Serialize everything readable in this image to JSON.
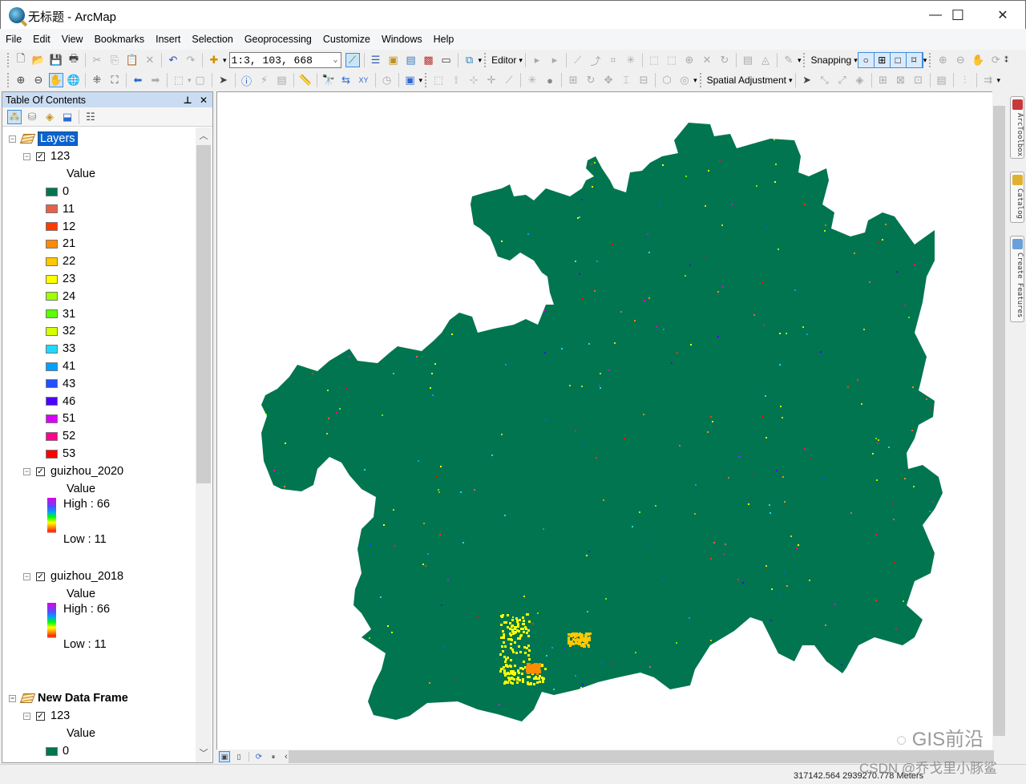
{
  "window": {
    "title": "无标题 - ArcMap",
    "minimize": "—",
    "maximize": "☐",
    "close": "✕"
  },
  "menu": [
    "File",
    "Edit",
    "View",
    "Bookmarks",
    "Insert",
    "Selection",
    "Geoprocessing",
    "Customize",
    "Windows",
    "Help"
  ],
  "toolbar": {
    "scale_value": "1:3, 103, 668",
    "editor_label": "Editor",
    "snapping_label": "Snapping",
    "spatial_adjustment_label": "Spatial Adjustment",
    "dropdown_arrow": "▾"
  },
  "toc": {
    "title": "Table Of Contents",
    "pin": "ᵖ",
    "close": "✕",
    "frames": [
      {
        "name": "Layers",
        "layers": [
          {
            "name": "123",
            "checked": true,
            "field": "Value",
            "classes": [
              {
                "label": "0",
                "color": "#007550"
              },
              {
                "label": "11",
                "color": "#e8604a"
              },
              {
                "label": "12",
                "color": "#ff3a00"
              },
              {
                "label": "21",
                "color": "#ff8c00"
              },
              {
                "label": "22",
                "color": "#ffc800"
              },
              {
                "label": "23",
                "color": "#ffff00"
              },
              {
                "label": "24",
                "color": "#a0ff00"
              },
              {
                "label": "31",
                "color": "#5aff00"
              },
              {
                "label": "32",
                "color": "#d8ff00"
              },
              {
                "label": "33",
                "color": "#20d8ff"
              },
              {
                "label": "41",
                "color": "#00a0ff"
              },
              {
                "label": "43",
                "color": "#2050ff"
              },
              {
                "label": "46",
                "color": "#4a00ff"
              },
              {
                "label": "51",
                "color": "#d800f8"
              },
              {
                "label": "52",
                "color": "#ff0090"
              },
              {
                "label": "53",
                "color": "#ff0000"
              }
            ]
          },
          {
            "name": "guizhou_2020",
            "checked": true,
            "field": "Value",
            "high": "High : 66",
            "low": "Low : 11"
          },
          {
            "name": "guizhou_2018",
            "checked": true,
            "field": "Value",
            "high": "High : 66",
            "low": "Low : 11"
          }
        ]
      },
      {
        "name": "New Data Frame",
        "layers": [
          {
            "name": "123",
            "checked": true,
            "field": "Value",
            "classes": [
              {
                "label": "0",
                "color": "#007550"
              }
            ]
          }
        ]
      }
    ]
  },
  "map": {
    "fill_color": "#00754f"
  },
  "side_tabs": [
    "ArcToolbox",
    "Catalog",
    "Create Features"
  ],
  "status": {
    "coordinates": "317142.564  2939270.778 Meters"
  },
  "watermarks": {
    "top": "GIS前沿",
    "bottom": "CSDN @乔戈里小豚鲨"
  }
}
